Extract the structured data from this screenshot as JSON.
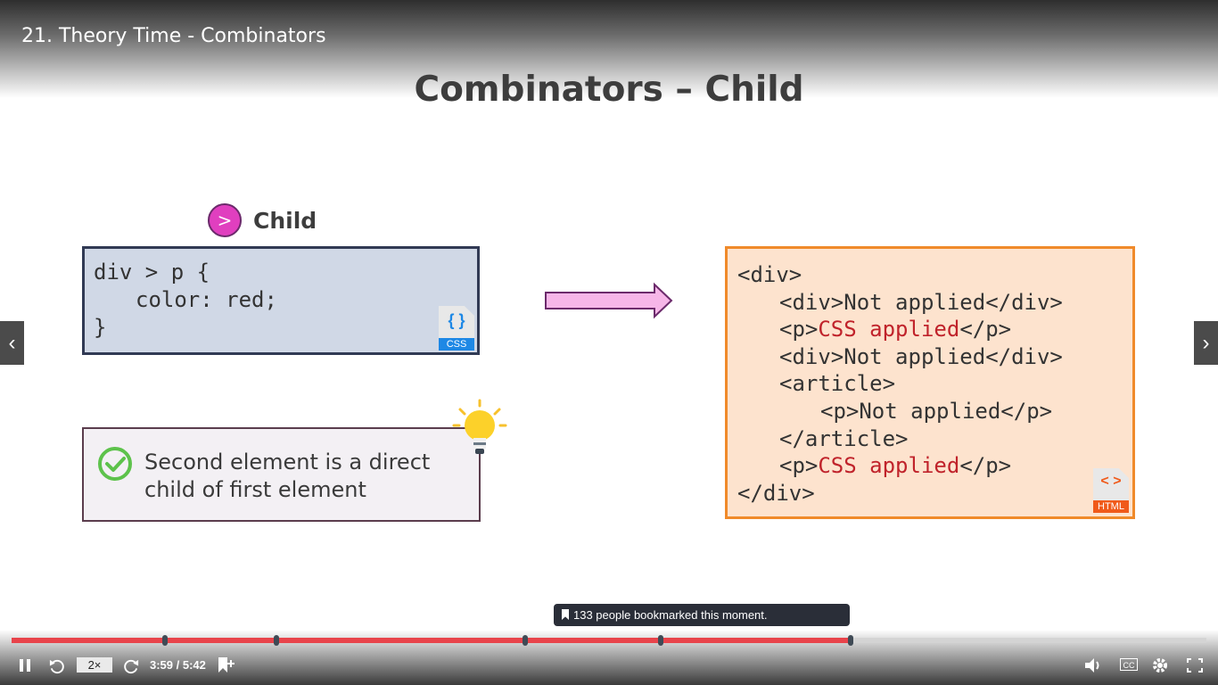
{
  "video": {
    "title": "21. Theory Time - Combinators"
  },
  "slide": {
    "title": "Combinators – Child",
    "badge": {
      "symbol": ">",
      "label": "Child",
      "color": "#e03fbf"
    },
    "css_code": {
      "line1": "div > p {",
      "line2": "color: red;",
      "line3": "}",
      "file_icon": {
        "glyph": "{ }",
        "tag": "CSS",
        "accent": "#1e88e5"
      }
    },
    "note": {
      "line1": "Second element is a direct",
      "line2": "child of first element"
    },
    "html_code": {
      "l1": "<div>",
      "l2": "<div>Not applied</div>",
      "l3_open": "<p>",
      "l3_mid": "CSS applied",
      "l3_close": "</p>",
      "l4": "<div>Not applied</div>",
      "l5": "<article>",
      "l6": "<p>Not applied</p>",
      "l7": "</article>",
      "l8_open": "<p>",
      "l8_mid": "CSS applied",
      "l8_close": "</p>",
      "l9": "</div>",
      "file_icon": {
        "glyph": "< >",
        "tag": "HTML",
        "accent": "#f05a1a"
      }
    },
    "highlight_color": "#c0232b"
  },
  "navigation": {
    "prev_icon": "‹",
    "next_icon": "›"
  },
  "player": {
    "tooltip": "133 people bookmarked this moment.",
    "progress_fraction": 0.702,
    "bookmark_positions": [
      0.128,
      0.222,
      0.43,
      0.543,
      0.702
    ],
    "speed": "2×",
    "time": "3:59 / 5:42",
    "cc_label": "CC",
    "icons": [
      "pause-icon",
      "rewind-icon",
      "forward-icon",
      "bookmark-add-icon",
      "volume-icon",
      "captions-icon",
      "settings-icon",
      "fullscreen-icon"
    ]
  }
}
